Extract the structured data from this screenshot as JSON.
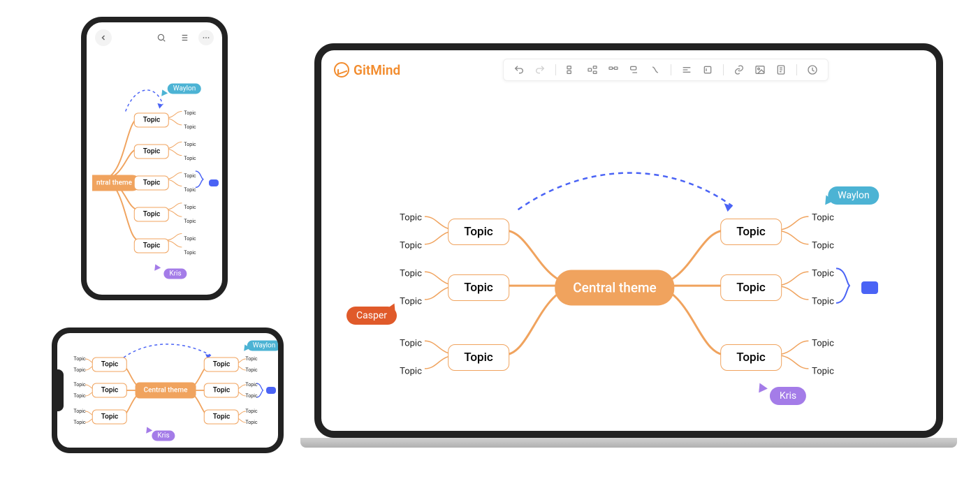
{
  "app": {
    "logo_text": "GitMind"
  },
  "toolbar": {
    "icons": [
      "undo",
      "redo",
      "sibling",
      "child",
      "subtopic",
      "floating",
      "relation",
      "format",
      "style",
      "link",
      "image",
      "note",
      "share"
    ]
  },
  "mindmap": {
    "central": "Central  theme",
    "topic": "Topic",
    "subtopic": "Topic",
    "users": {
      "waylon": "Waylon",
      "kris": "Kris",
      "casper": "Casper"
    }
  },
  "phone_portrait": {
    "central": "ntral  theme",
    "topic": "Topic",
    "subtopic": "Topic"
  },
  "phone_landscape": {
    "central": "Central  theme",
    "topic": "Topic",
    "subtopic": "Topic"
  }
}
